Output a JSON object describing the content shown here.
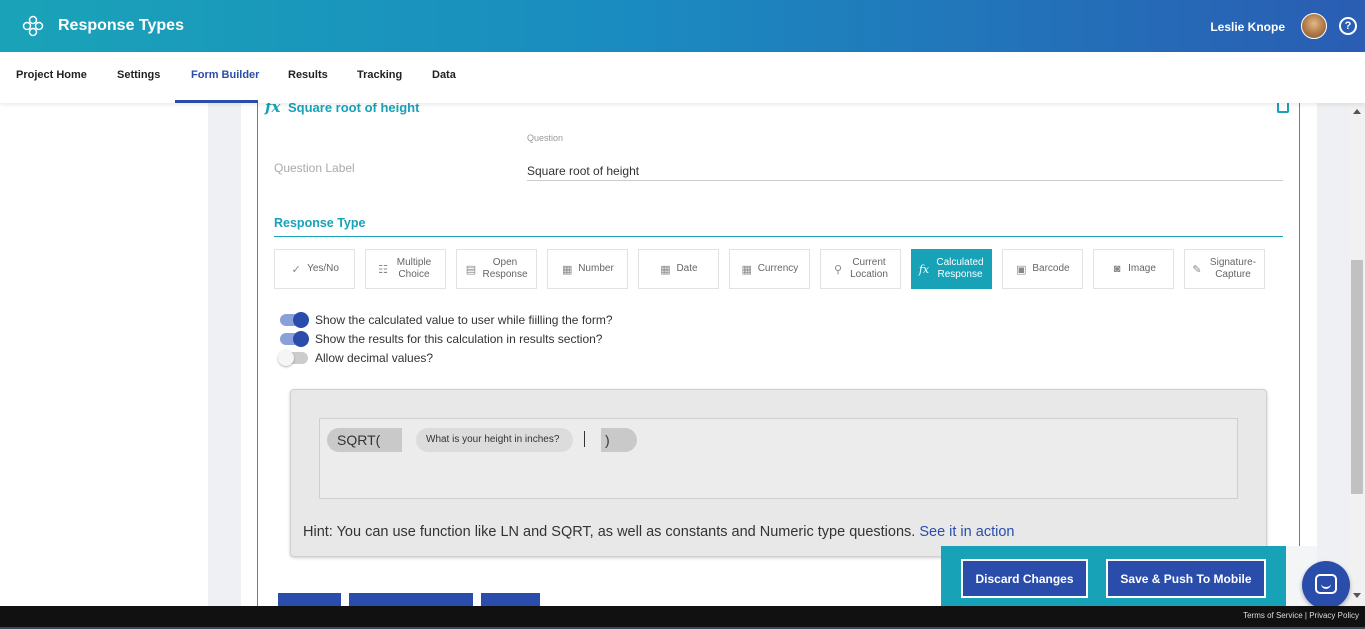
{
  "app": {
    "title": "Response Types",
    "user_name": "Leslie Knope",
    "help": "?"
  },
  "nav": {
    "items": [
      "Project Home",
      "Settings",
      "Form Builder",
      "Results",
      "Tracking",
      "Data"
    ],
    "active": "Form Builder"
  },
  "question": {
    "title": "Square root of height",
    "field_small_label": "Question",
    "label": "Question Label",
    "value": "Square root of height"
  },
  "response_type": {
    "heading": "Response Type",
    "types": [
      {
        "label": "Yes/No",
        "icon": "yes-no-icon",
        "glyph": "✓"
      },
      {
        "label": "Multiple Choice",
        "icon": "list-icon",
        "glyph": "☷"
      },
      {
        "label": "Open Response",
        "icon": "text-box-icon",
        "glyph": "▤"
      },
      {
        "label": "Number",
        "icon": "calculator-icon",
        "glyph": "▦"
      },
      {
        "label": "Date",
        "icon": "calendar-icon",
        "glyph": "▦"
      },
      {
        "label": "Currency",
        "icon": "currency-icon",
        "glyph": "▦"
      },
      {
        "label": "Current Location",
        "icon": "map-pin-icon",
        "glyph": "⚲"
      },
      {
        "label": "Calculated Response",
        "icon": "fx-icon",
        "glyph": "fx"
      },
      {
        "label": "Barcode",
        "icon": "barcode-icon",
        "glyph": "▣"
      },
      {
        "label": "Image",
        "icon": "camera-icon",
        "glyph": "◙"
      },
      {
        "label": "Signature-Capture",
        "icon": "pen-icon",
        "glyph": "✎"
      }
    ],
    "active": "Calculated Response"
  },
  "toggles": [
    {
      "label": "Show the calculated value to user while fiilling the form?",
      "on": true
    },
    {
      "label": "Show the results for this calculation in results section?",
      "on": true
    },
    {
      "label": "Allow decimal values?",
      "on": false
    }
  ],
  "formula": {
    "function": "SQRT(",
    "question_chip": "What is your height in inches?",
    "close": ")",
    "hint": "Hint: You can use function like LN and SQRT, as well as constants and Numeric type questions.",
    "hint_link": "See it in action"
  },
  "actions": {
    "discard": "Discard Changes",
    "save": "Save & Push To Mobile"
  },
  "footer": {
    "terms": "Terms of Service",
    "separator": "|",
    "privacy": "Privacy Policy"
  },
  "colors": {
    "teal": "#17a2b8",
    "blue": "#2a4dab"
  }
}
